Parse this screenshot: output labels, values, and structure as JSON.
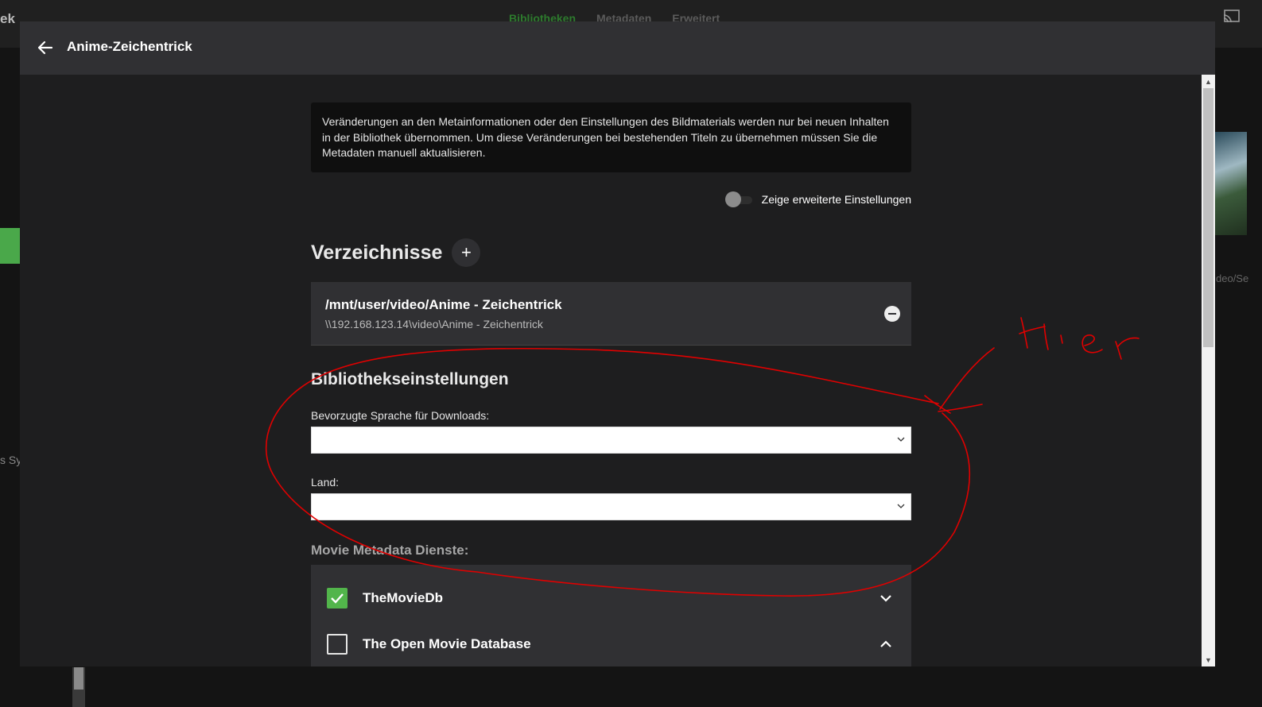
{
  "background": {
    "brand_fragment": "ek",
    "tabs": [
      "Bibliotheken",
      "Metadaten",
      "Erweitert"
    ],
    "side_text": "s Syn",
    "right_text": "deo/Se"
  },
  "dialog": {
    "title": "Anime-Zeichentrick",
    "notice": "Veränderungen an den Metainformationen oder den Einstellungen des Bildmaterials werden nur bei neuen Inhalten in der Bibliothek übernommen. Um diese Veränderungen bei bestehenden Titeln zu übernehmen müssen Sie die Metadaten manuell aktualisieren.",
    "advanced_toggle": {
      "label": "Zeige erweiterte Einstellungen",
      "on": false
    },
    "folders_title": "Verzeichnisse",
    "add_label": "+",
    "folders": [
      {
        "path": "/mnt/user/video/Anime - Zeichentrick",
        "network_path": "\\\\192.168.123.14\\video\\Anime - Zeichentrick"
      }
    ],
    "library_settings_title": "Bibliothekseinstellungen",
    "language_label": "Bevorzugte Sprache für Downloads:",
    "language_value": "",
    "country_label": "Land:",
    "country_value": "",
    "metadata_label": "Movie Metadata Dienste:",
    "metadata_services": [
      {
        "name": "TheMovieDb",
        "checked": true,
        "expanded": false
      },
      {
        "name": "The Open Movie Database",
        "checked": false,
        "expanded": true
      }
    ]
  },
  "annotation": {
    "text": "Hier",
    "color": "#e00000"
  }
}
